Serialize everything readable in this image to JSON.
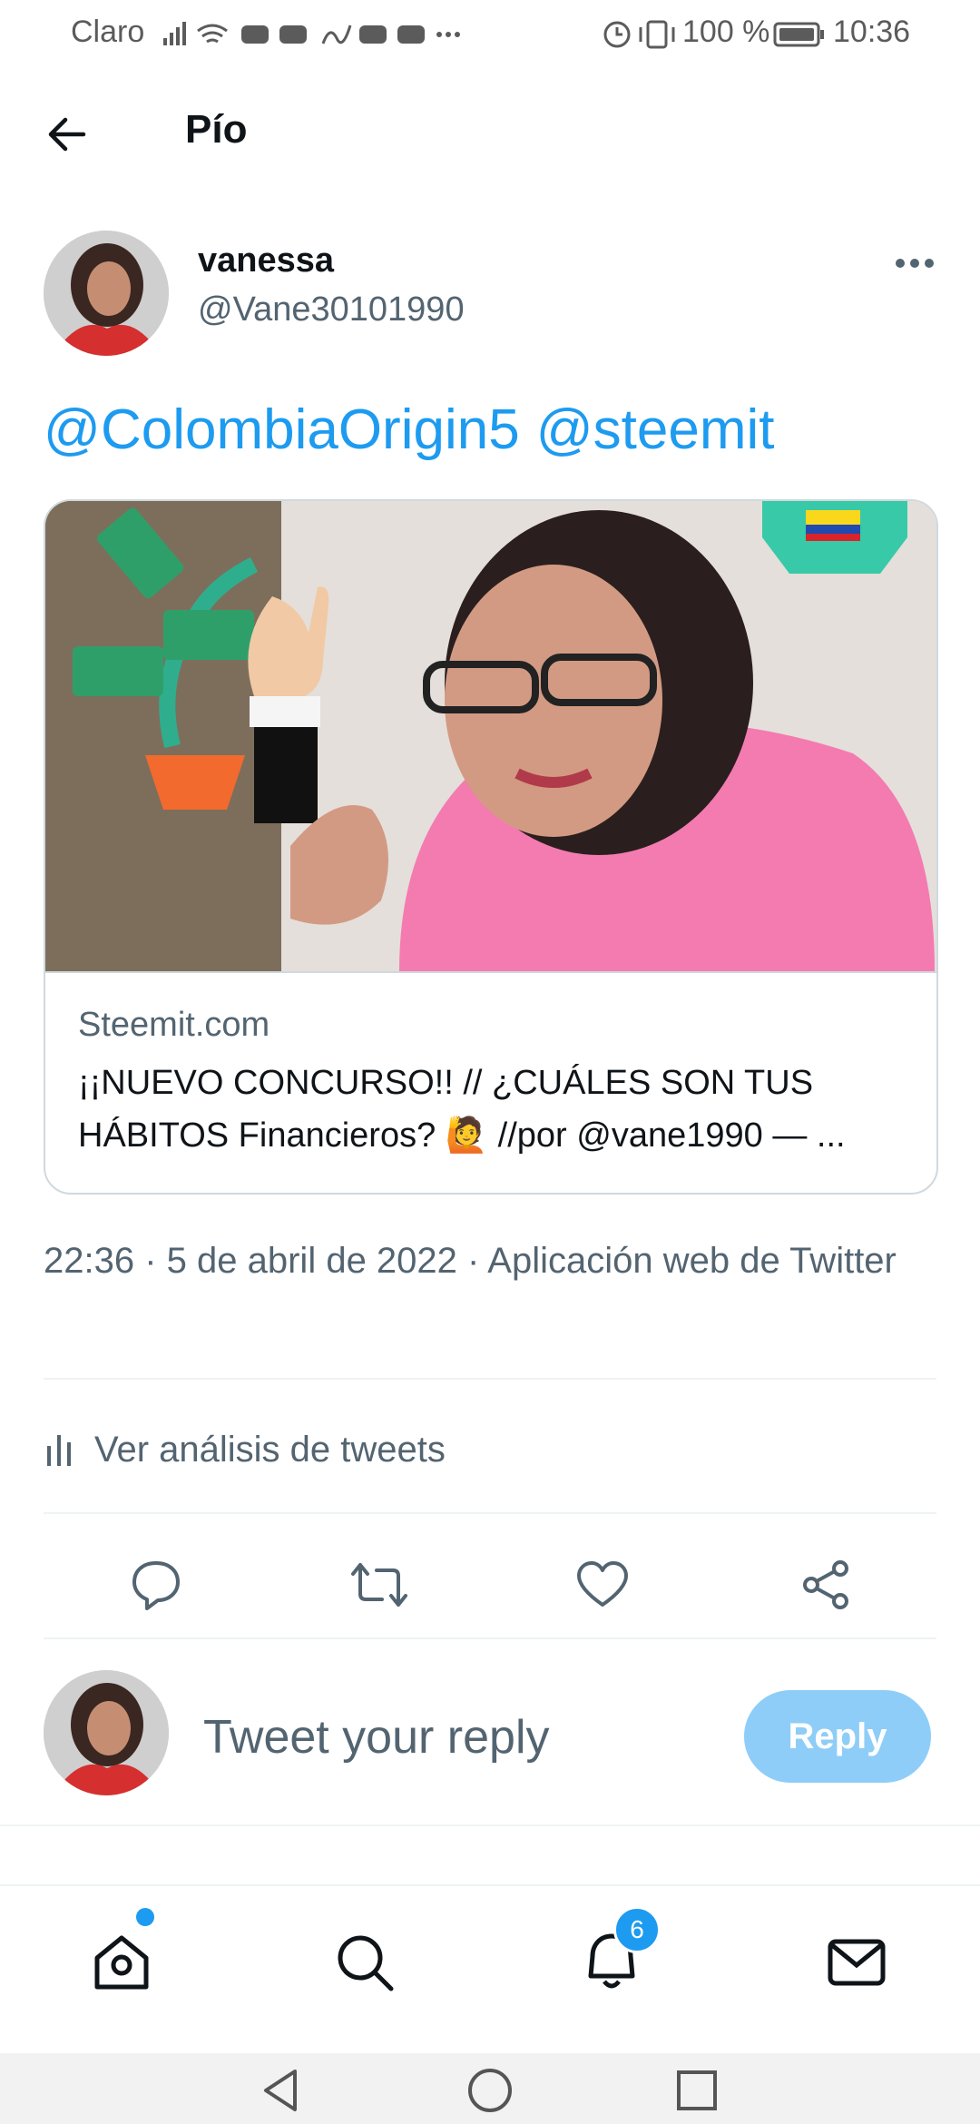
{
  "status_bar": {
    "carrier": "Claro",
    "battery": "100 %",
    "time": "10:36"
  },
  "header": {
    "title": "Pío",
    "back_icon": "arrow-left-icon"
  },
  "tweet": {
    "display_name": "vanessa",
    "handle": "@Vane30101990",
    "mentions": [
      "@ColombiaOrigin5",
      "@steemit"
    ],
    "card": {
      "domain": "Steemit.com",
      "title": "¡¡NUEVO CONCURSO!! // ¿CUÁLES SON TUS HÁBITOS Financieros? 🙋 //por @vane1990 — ..."
    },
    "time": "22:36",
    "date": "5 de abril de 2022",
    "source": "Aplicación web de Twitter",
    "analytics_label": "Ver análisis de tweets"
  },
  "reply": {
    "placeholder": "Tweet your reply",
    "button_label": "Reply"
  },
  "bottom_nav": {
    "notifications_count": "6",
    "items": [
      "home-icon",
      "search-icon",
      "bell-icon",
      "mail-icon"
    ]
  },
  "colors": {
    "accent": "#1d9bf0",
    "secondary_text": "#536471",
    "reply_button_disabled": "#8ecdf8"
  }
}
